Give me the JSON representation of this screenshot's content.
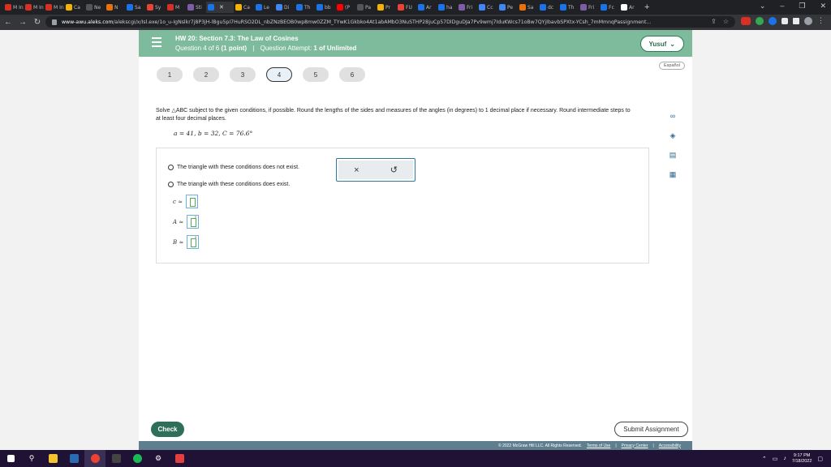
{
  "browser": {
    "tabs": [
      {
        "label": "M Ini",
        "color": "#d93025"
      },
      {
        "label": "M Ini",
        "color": "#d93025"
      },
      {
        "label": "M Inl",
        "color": "#d93025"
      },
      {
        "label": "Ca",
        "color": "#f4b400"
      },
      {
        "label": "Ne",
        "color": "#555555"
      },
      {
        "label": "N",
        "color": "#e8710a"
      },
      {
        "label": "Sa",
        "color": "#1a73e8"
      },
      {
        "label": "Sy",
        "color": "#ea4335"
      },
      {
        "label": "M",
        "color": "#d93025"
      },
      {
        "label": "Sti",
        "color": "#7b5ea7"
      },
      {
        "label": "",
        "color": "#1a73e8",
        "active": true
      },
      {
        "label": "Ca",
        "color": "#f4b400"
      },
      {
        "label": "Le",
        "color": "#1a73e8"
      },
      {
        "label": "Di",
        "color": "#4285f4"
      },
      {
        "label": "Th",
        "color": "#1a73e8"
      },
      {
        "label": "bb",
        "color": "#1a73e8"
      },
      {
        "label": "(P",
        "color": "#ff0000"
      },
      {
        "label": "Pa",
        "color": "#555555"
      },
      {
        "label": "Pr",
        "color": "#f4b400"
      },
      {
        "label": "FU",
        "color": "#ea4335"
      },
      {
        "label": "Ar",
        "color": "#1a73e8"
      },
      {
        "label": "ha",
        "color": "#1a73e8"
      },
      {
        "label": "Fri",
        "color": "#7b5ea7"
      },
      {
        "label": "Cc",
        "color": "#4285f4"
      },
      {
        "label": "Pe",
        "color": "#4285f4"
      },
      {
        "label": "Sa",
        "color": "#e8710a"
      },
      {
        "label": "dc",
        "color": "#1a73e8"
      },
      {
        "label": "Th",
        "color": "#1a73e8"
      },
      {
        "label": "Fri",
        "color": "#7b5ea7"
      },
      {
        "label": "Fc",
        "color": "#1a73e8"
      },
      {
        "label": "Ar",
        "color": "#ffffff"
      }
    ],
    "url_host": "www-awu.aleks.com",
    "url_path": "/alekscgi/x/Isl.exe/1o_u-IgNslkr7j8P3jH-lBgu5pI7HuRSO2DL_nbZNzBEOB0wp8mw0ZZM_TYwK1Gkbko4At1abAMbO3NuSTHP2BjuCp57DlDguDJa7Pv9wmj7IduKWcs71oBw7QYjIbavbSPXtx-YCsh_7mMmnqPassignment..."
  },
  "header": {
    "title": "HW 20: Section 7.3: The Law of Cosines",
    "question_info": "Question 4 of 6",
    "points": "(1 point)",
    "attempt_label": "Question Attempt:",
    "attempt_value": "1 of Unlimited",
    "user_name": "Yusuf",
    "language": "Español"
  },
  "question_nav": [
    {
      "label": "1"
    },
    {
      "label": "2"
    },
    {
      "label": "3"
    },
    {
      "label": "4",
      "active": true
    },
    {
      "label": "5"
    },
    {
      "label": "6"
    }
  ],
  "problem": {
    "prompt": "Solve △ABC subject to the given conditions, if possible. Round the lengths of the sides and measures of the angles (in degrees) to 1 decimal place if necessary. Round intermediate steps to at least four decimal places.",
    "given": "a = 41,  b = 32,  C = 76.6°"
  },
  "answer": {
    "option_none": "The triangle with these conditions does not exist.",
    "option_exists": "The triangle with these conditions does exist.",
    "fields": [
      {
        "label": "c ≈",
        "unit": ""
      },
      {
        "label": "A ≈",
        "unit": "°"
      },
      {
        "label": "B ≈",
        "unit": "°"
      }
    ],
    "clear_symbol": "×",
    "undo_symbol": "↺"
  },
  "actions": {
    "check": "Check",
    "submit": "Submit Assignment"
  },
  "footer": {
    "copyright": "© 2022 McGraw Hill LLC. All Rights Reserved.",
    "terms": "Terms of Use",
    "privacy": "Privacy Center",
    "accessibility": "Accessibility"
  },
  "taskbar": {
    "time": "9:17 PM",
    "date": "7/18/2022"
  }
}
